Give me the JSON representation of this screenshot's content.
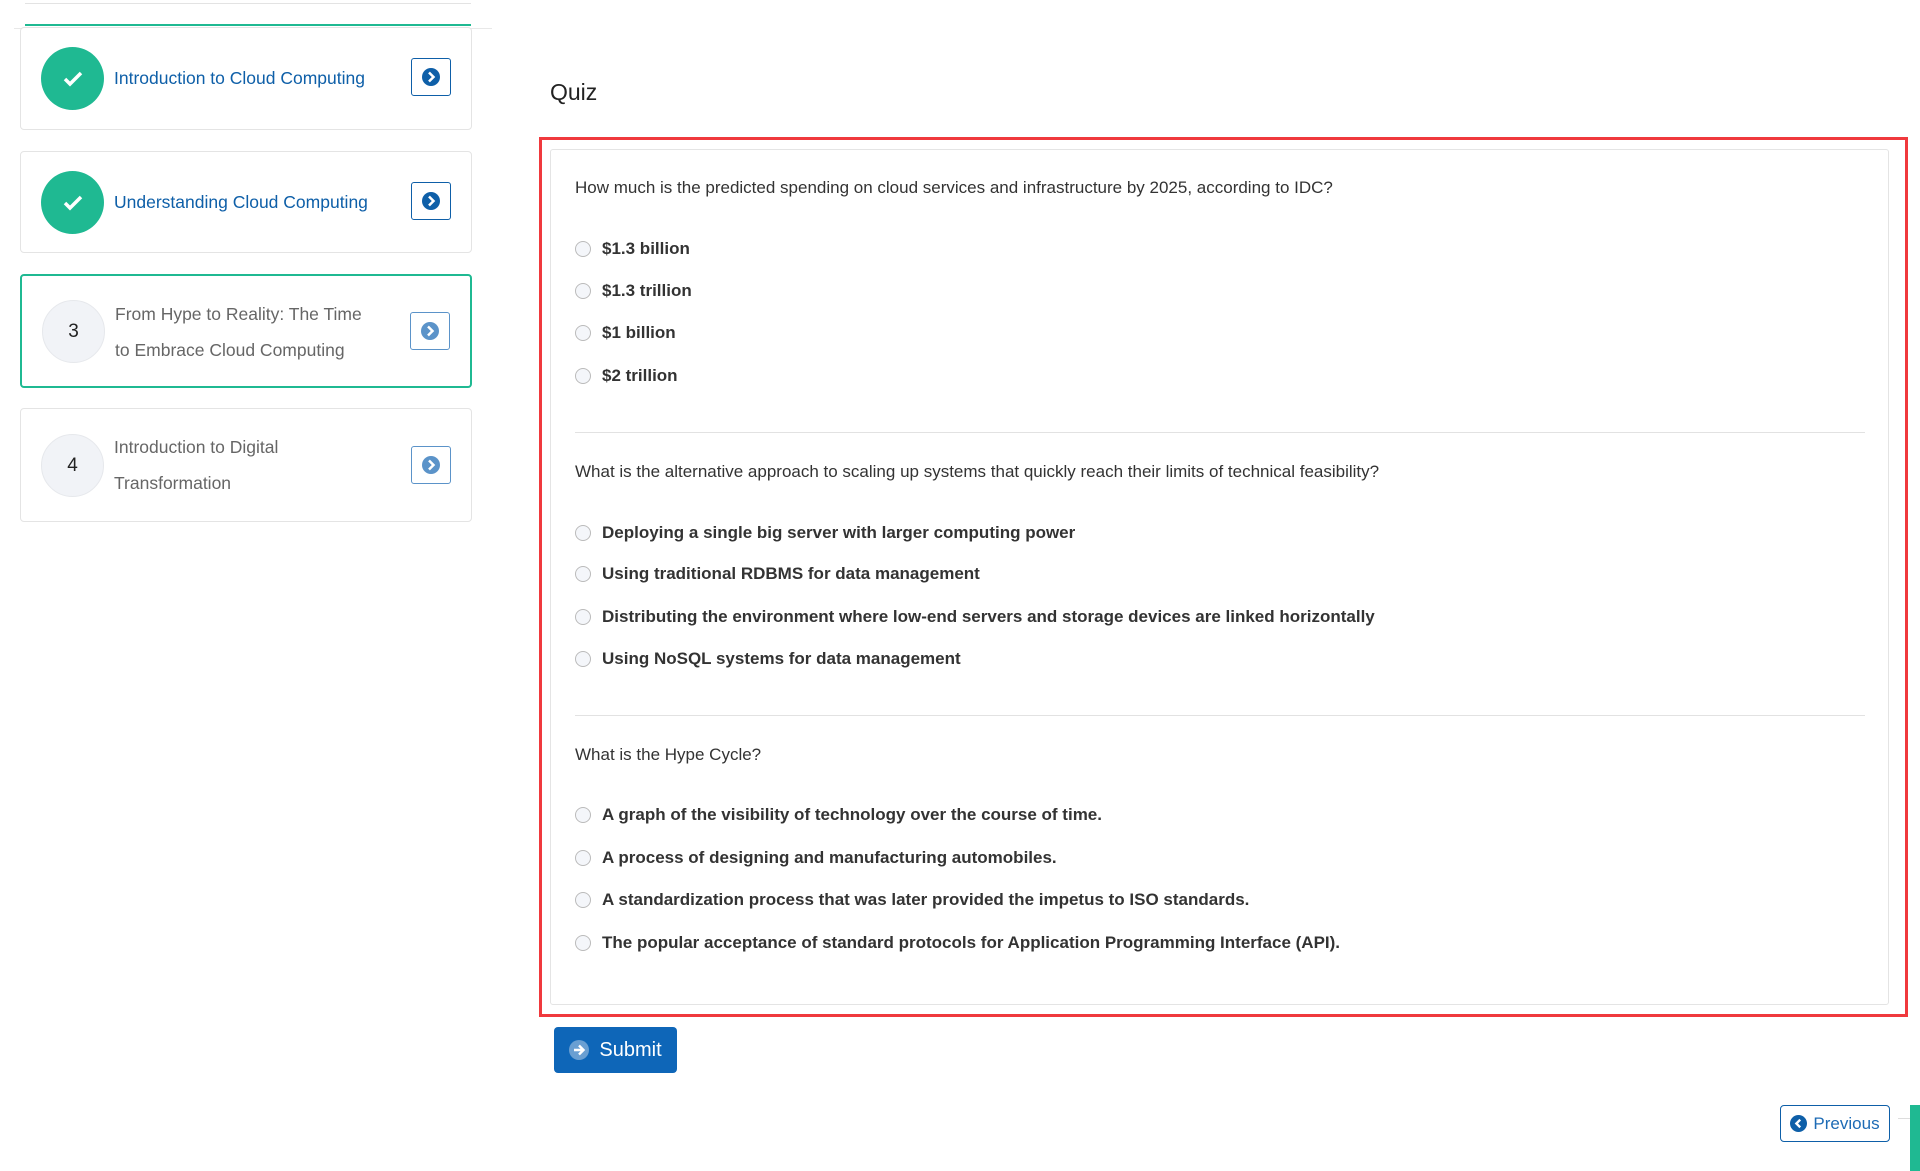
{
  "sidebar": {
    "lessons": [
      {
        "number": "1",
        "title": "Introduction to Cloud Computing",
        "status": "completed"
      },
      {
        "number": "2",
        "title": "Understanding Cloud Computing",
        "status": "completed"
      },
      {
        "number": "3",
        "title_line1": "From Hype to Reality: The Time",
        "title_line2": "to Embrace Cloud Computing",
        "status": "active"
      },
      {
        "number": "4",
        "title_line1": "Introduction to Digital",
        "title_line2": "Transformation",
        "status": "pending"
      }
    ]
  },
  "quiz": {
    "title": "Quiz",
    "questions": [
      {
        "text": "How much is the predicted spending on cloud services and infrastructure by 2025, according to IDC?",
        "options": [
          "$1.3 billion",
          "$1.3 trillion",
          "$1 billion",
          "$2 trillion"
        ]
      },
      {
        "text": "What is the alternative approach to scaling up systems that quickly reach their limits of technical feasibility?",
        "options": [
          "Deploying a single big server with larger computing power",
          "Using traditional RDBMS for data management",
          "Distributing the environment where low-end servers and storage devices are linked horizontally",
          "Using NoSQL systems for data management"
        ]
      },
      {
        "text": "What is the Hype Cycle?",
        "options": [
          "A graph of the visibility of technology over the course of time.",
          "A process of designing and manufacturing automobiles.",
          "A standardization process that was later provided the impetus to ISO standards.",
          "The popular acceptance of standard protocols for Application Programming Interface (API)."
        ]
      }
    ],
    "submit_label": "Submit"
  },
  "nav": {
    "previous_label": "Previous"
  },
  "colors": {
    "accent_green": "#1fb992",
    "primary_blue": "#0e66b8",
    "highlight_red": "#f0393d"
  }
}
